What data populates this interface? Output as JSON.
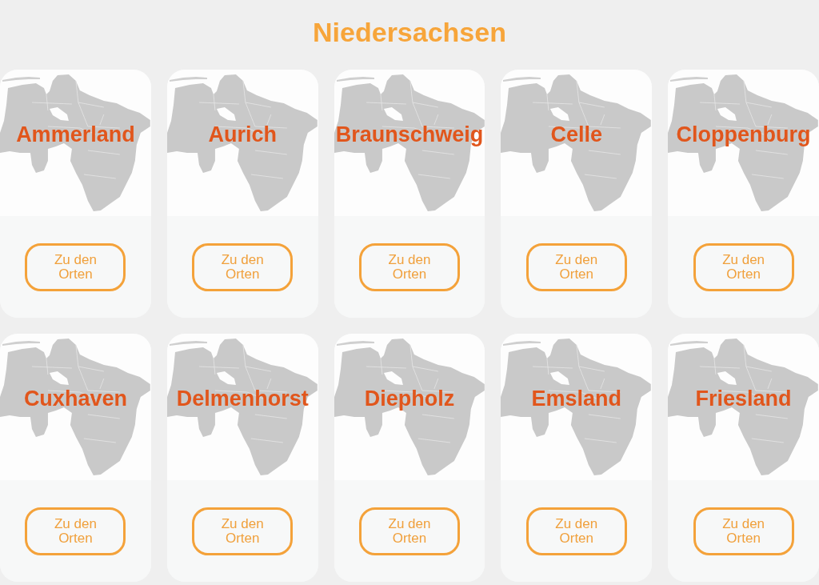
{
  "page_title": "Niedersachsen",
  "cards": [
    {
      "title": "Ammerland",
      "button": "Zu den Orten"
    },
    {
      "title": "Aurich",
      "button": "Zu den Orten"
    },
    {
      "title": "Braunschweig",
      "button": "Zu den Orten"
    },
    {
      "title": "Celle",
      "button": "Zu den Orten"
    },
    {
      "title": "Cloppenburg",
      "button": "Zu den Orten"
    },
    {
      "title": "Cuxhaven",
      "button": "Zu den Orten"
    },
    {
      "title": "Delmenhorst",
      "button": "Zu den Orten"
    },
    {
      "title": "Diepholz",
      "button": "Zu den Orten"
    },
    {
      "title": "Emsland",
      "button": "Zu den Orten"
    },
    {
      "title": "Friesland",
      "button": "Zu den Orten"
    }
  ]
}
